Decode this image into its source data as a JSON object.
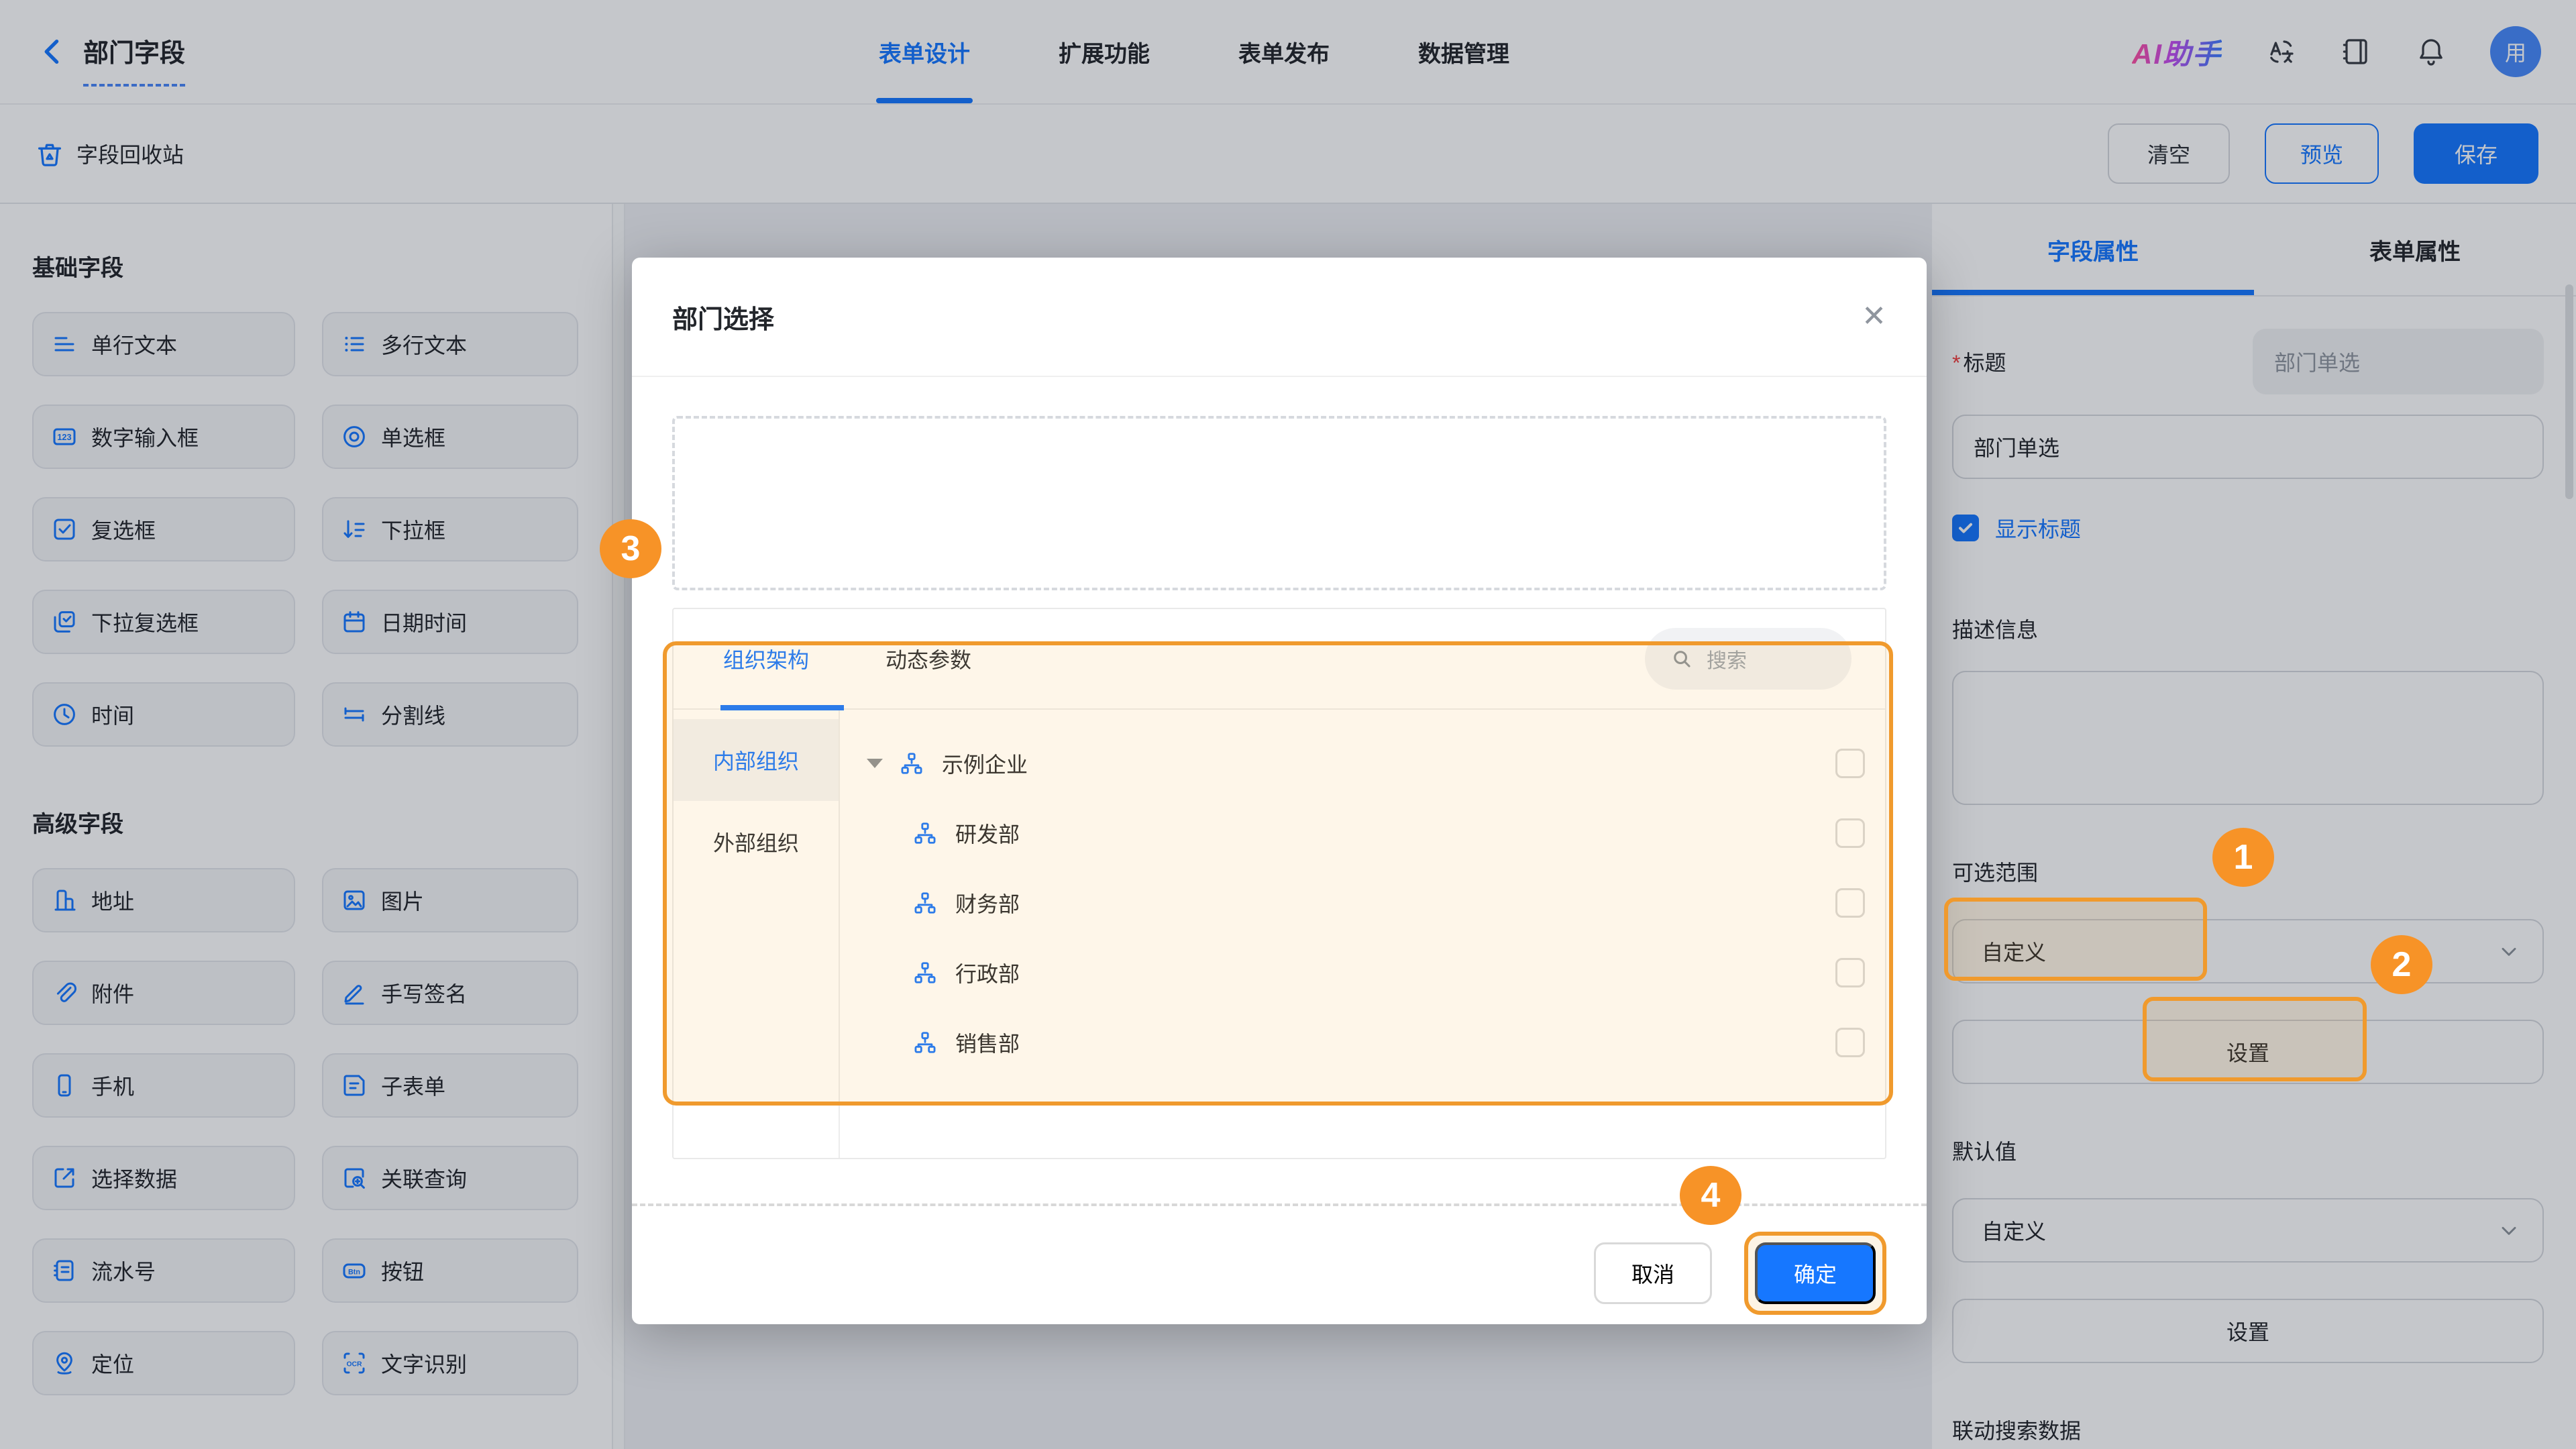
{
  "header": {
    "back_title": "部门字段",
    "nav": [
      {
        "label": "表单设计"
      },
      {
        "label": "扩展功能"
      },
      {
        "label": "表单发布"
      },
      {
        "label": "数据管理"
      }
    ],
    "ai_assistant": "AI助手",
    "avatar_text": "用"
  },
  "toolbar": {
    "recycle_bin": "字段回收站",
    "clear": "清空",
    "preview": "预览",
    "save": "保存"
  },
  "sidebar": {
    "basic_section": "基础字段",
    "basic_items": [
      {
        "label": "单行文本"
      },
      {
        "label": "多行文本"
      },
      {
        "label": "数字输入框"
      },
      {
        "label": "单选框"
      },
      {
        "label": "复选框"
      },
      {
        "label": "下拉框"
      },
      {
        "label": "下拉复选框"
      },
      {
        "label": "日期时间"
      },
      {
        "label": "时间"
      },
      {
        "label": "分割线"
      }
    ],
    "advanced_section": "高级字段",
    "advanced_items": [
      {
        "label": "地址"
      },
      {
        "label": "图片"
      },
      {
        "label": "附件"
      },
      {
        "label": "手写签名"
      },
      {
        "label": "手机"
      },
      {
        "label": "子表单"
      },
      {
        "label": "选择数据"
      },
      {
        "label": "关联查询"
      },
      {
        "label": "流水号"
      },
      {
        "label": "按钮"
      },
      {
        "label": "定位"
      },
      {
        "label": "文字识别"
      }
    ]
  },
  "modal": {
    "title": "部门选择",
    "tab_org": "组织架构",
    "tab_dynamic": "动态参数",
    "search_placeholder": "搜索",
    "scope_internal": "内部组织",
    "scope_external": "外部组织",
    "tree": {
      "root": "示例企业",
      "children": [
        {
          "label": "研发部"
        },
        {
          "label": "财务部"
        },
        {
          "label": "行政部"
        },
        {
          "label": "销售部"
        }
      ]
    },
    "cancel": "取消",
    "ok": "确定"
  },
  "panel": {
    "tab_field": "字段属性",
    "tab_form": "表单属性",
    "title_label": "标题",
    "title_preview": "部门单选",
    "title_value": "部门单选",
    "show_title_label": "显示标题",
    "desc_label": "描述信息",
    "range_label": "可选范围",
    "range_value": "自定义",
    "range_setting": "设置",
    "default_label": "默认值",
    "default_value": "自定义",
    "default_setting": "设置",
    "linkage_label": "联动搜索数据"
  },
  "badges": {
    "one": "1",
    "two": "2",
    "three": "3",
    "four": "4"
  },
  "colors": {
    "primary": "#1677FF",
    "highlight": "#F09A2D",
    "badge": "#F79327"
  }
}
